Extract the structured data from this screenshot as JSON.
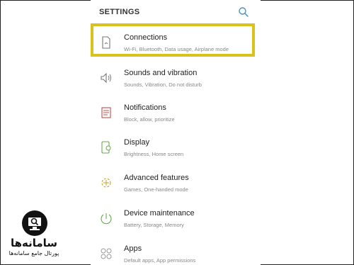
{
  "header": {
    "title": "SETTINGS",
    "search_icon": "search-icon"
  },
  "items": [
    {
      "label": "Connections",
      "sub": "Wi-Fi, Bluetooth, Data usage, Airplane mode",
      "icon": "connections-icon",
      "icon_color": "#777777"
    },
    {
      "label": "Sounds and vibration",
      "sub": "Sounds, Vibration, Do not disturb",
      "icon": "sound-icon",
      "icon_color": "#777777"
    },
    {
      "label": "Notifications",
      "sub": "Block, allow, prioritize",
      "icon": "notifications-icon",
      "icon_color": "#c0504d"
    },
    {
      "label": "Display",
      "sub": "Brightness, Home screen",
      "icon": "display-icon",
      "icon_color": "#6aa84f"
    },
    {
      "label": "Advanced features",
      "sub": "Games, One-handed mode",
      "icon": "advanced-features-icon",
      "icon_color": "#c9a227"
    },
    {
      "label": "Device maintenance",
      "sub": "Battery, Storage, Memory",
      "icon": "device-maintenance-icon",
      "icon_color": "#6aa84f"
    },
    {
      "label": "Apps",
      "sub": "Default apps, App permissions",
      "icon": "apps-icon",
      "icon_color": "#999999"
    }
  ],
  "highlight_color": "#d9c21b",
  "accent_color": "#4a90c2",
  "watermark": {
    "title": "سامانه‌ها",
    "subtitle": "پورتال جامع سامانه‌ها"
  }
}
